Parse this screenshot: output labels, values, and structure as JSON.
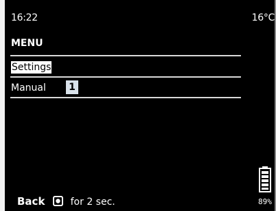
{
  "status": {
    "time": "16:22",
    "temperature": "16°C"
  },
  "menu": {
    "title": "MENU",
    "items": [
      {
        "label": "Settings",
        "selected": true
      },
      {
        "label": "Manual",
        "value": "1"
      }
    ]
  },
  "battery": {
    "percent_text": "89%",
    "level": 0.89,
    "icon": "battery-icon"
  },
  "footer": {
    "back_label": "Back",
    "back_suffix": "for 2 sec.",
    "button_icon": "hold-button-icon"
  }
}
